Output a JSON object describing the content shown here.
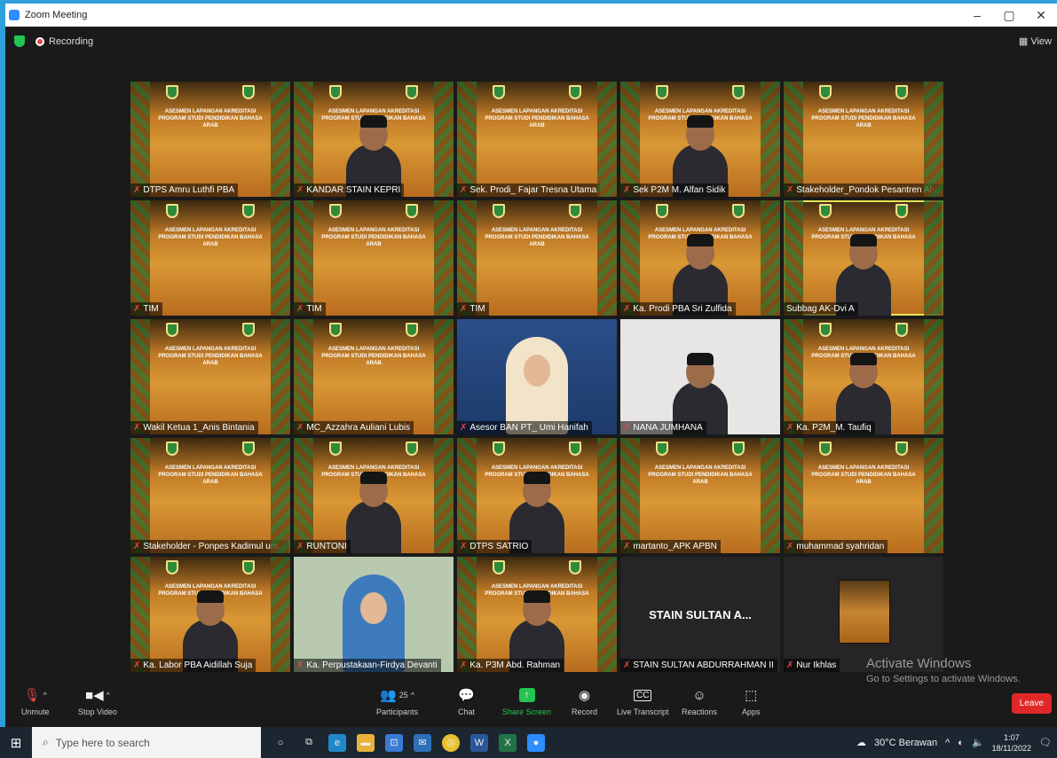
{
  "window": {
    "title": "Zoom Meeting",
    "controls": [
      "–",
      "▢",
      "✕"
    ]
  },
  "top": {
    "recording": "Recording",
    "view": "View"
  },
  "banner_text": "ASESMEN LAPANGAN AKREDITASI PROGRAM STUDI PENDIDIKAN BAHASA ARAB",
  "participants": [
    {
      "name": "DTPS Amru Luthfi PBA",
      "kind": "banner"
    },
    {
      "name": "KANDAR STAIN KEPRI",
      "kind": "banner-person"
    },
    {
      "name": "Sek. Prodi_ Fajar Tresna Utama",
      "kind": "banner"
    },
    {
      "name": "Sek P2M M. Alfan Sidik",
      "kind": "banner-person"
    },
    {
      "name": "Stakeholder_Pondok Pesantren Al-...",
      "kind": "banner"
    },
    {
      "name": "TIM",
      "kind": "banner"
    },
    {
      "name": "TIM",
      "kind": "banner"
    },
    {
      "name": "TIM",
      "kind": "banner"
    },
    {
      "name": "Ka. Prodi PBA Sri Zulfida",
      "kind": "banner-person"
    },
    {
      "name": "Subbag AK-Dvi A",
      "kind": "banner-person",
      "active": true
    },
    {
      "name": "Wakil Ketua 1_Anis Bintania",
      "kind": "banner"
    },
    {
      "name": "MC_Azzahra Auliani Lubis",
      "kind": "banner"
    },
    {
      "name": "Asesor BAN PT_ Umi Hanifah",
      "kind": "hijab-blue"
    },
    {
      "name": "NANA JUMHANA",
      "kind": "white-person"
    },
    {
      "name": "Ka. P2M_M. Taufiq",
      "kind": "banner-person"
    },
    {
      "name": "Stakeholder - Ponpes Kadimul um...",
      "kind": "banner"
    },
    {
      "name": "RUNTONI",
      "kind": "banner-person"
    },
    {
      "name": "DTPS SATRIO",
      "kind": "banner-person"
    },
    {
      "name": "martanto_APK APBN",
      "kind": "banner"
    },
    {
      "name": "muhammad syahridan",
      "kind": "banner"
    },
    {
      "name": "Ka. Labor PBA Aidillah Suja",
      "kind": "banner-person"
    },
    {
      "name": "Ka. Perpustakaan-Firdya Devanti",
      "kind": "green-hijab"
    },
    {
      "name": "Ka. P3M Abd. Rahman",
      "kind": "banner-person"
    },
    {
      "name": "STAIN SULTAN ABDURRAHMAN II",
      "kind": "stain",
      "display": "STAIN SULTAN A..."
    },
    {
      "name": "Nur Ikhlas",
      "kind": "small"
    }
  ],
  "watermark": {
    "line1": "Activate Windows",
    "line2": "Go to Settings to activate Windows."
  },
  "toolbar": {
    "unmute": "Unmute",
    "stop_video": "Stop Video",
    "participants": "Participants",
    "participants_count": "25",
    "chat": "Chat",
    "share_screen": "Share Screen",
    "record": "Record",
    "live_transcript": "Live Transcript",
    "reactions": "Reactions",
    "apps": "Apps",
    "leave": "Leave"
  },
  "taskbar": {
    "search_placeholder": "Type here to search",
    "weather": "30°C Berawan",
    "time": "1:07",
    "date": "18/11/2022"
  },
  "colors": {
    "accent": "#2d9fd9",
    "share": "#23c552",
    "leave": "#e02828",
    "active_outline": "#e8e356"
  }
}
